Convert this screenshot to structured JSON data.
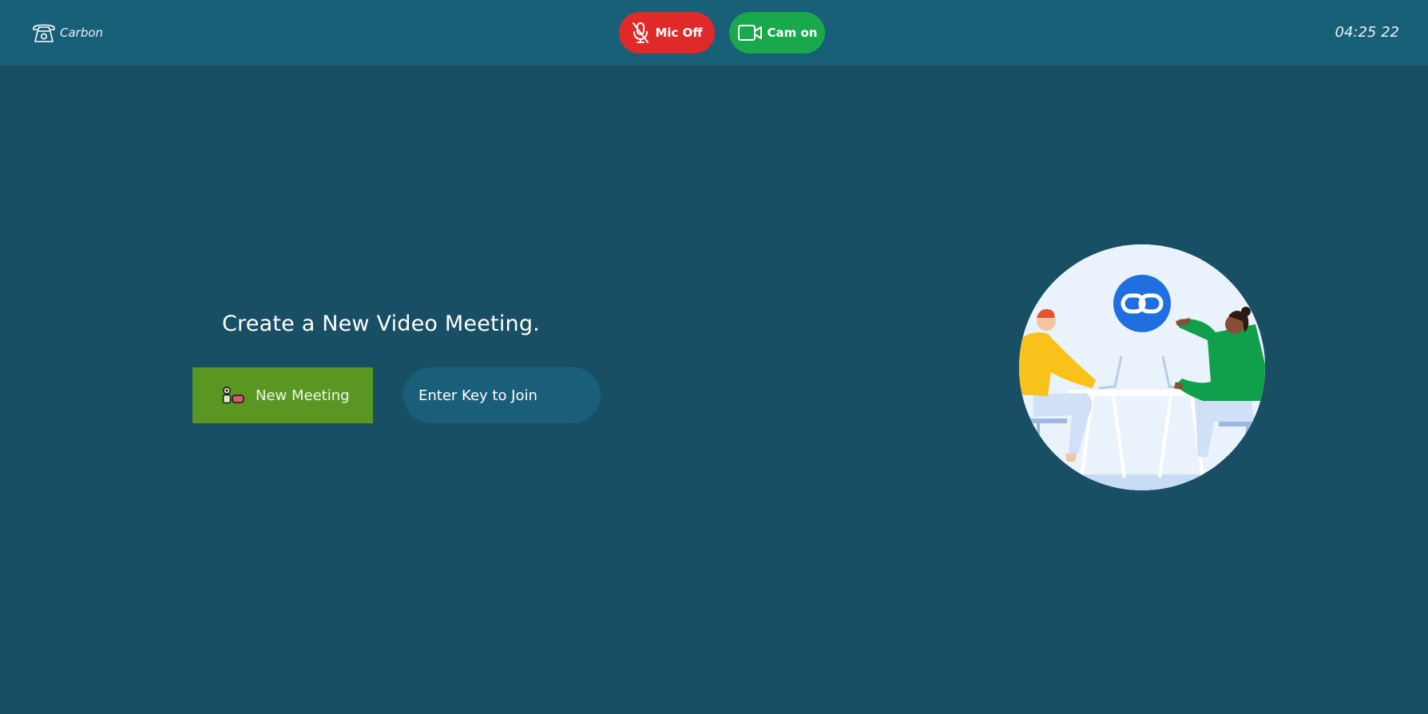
{
  "header": {
    "brand_name": "Carbon",
    "brand_icon": "telephone-icon",
    "mic_label": "Mic Off",
    "mic_icon": "mic-off-icon",
    "mic_color": "#e02a2a",
    "cam_label": "Cam on",
    "cam_icon": "video-camera-icon",
    "cam_color": "#1aa84c",
    "clock": "04:25 22"
  },
  "main": {
    "title": "Create a New Video Meeting.",
    "new_meeting_label": "New Meeting",
    "new_meeting_icon": "video-camera-icon",
    "new_meeting_color": "#5a9722",
    "join_placeholder": "Enter Key to Join"
  },
  "illustration": {
    "icon": "link-icon",
    "description_name": "meeting-illustration"
  },
  "colors": {
    "background": "#184f64",
    "header": "#185f78",
    "input": "#1a5f79"
  }
}
